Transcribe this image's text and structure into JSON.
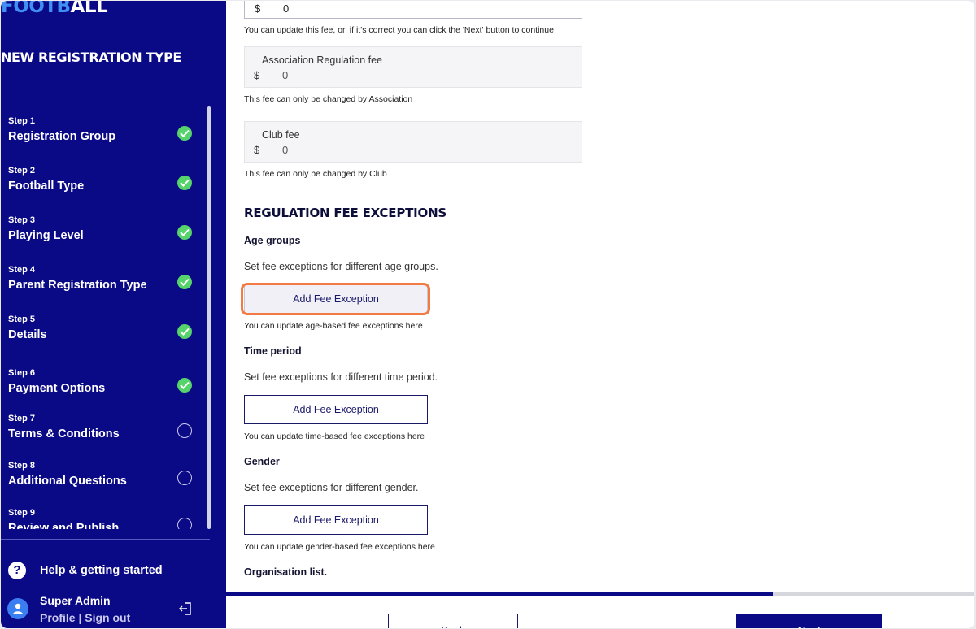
{
  "sidebar": {
    "logo_blue": "FOOTB",
    "logo_white": "ALL",
    "title": "NEW REGISTRATION TYPE",
    "steps": [
      {
        "num": "Step 1",
        "name": "Registration Group",
        "status": "complete"
      },
      {
        "num": "Step 2",
        "name": "Football Type",
        "status": "complete"
      },
      {
        "num": "Step 3",
        "name": "Playing Level",
        "status": "complete"
      },
      {
        "num": "Step 4",
        "name": "Parent Registration Type",
        "status": "complete"
      },
      {
        "num": "Step 5",
        "name": "Details",
        "status": "complete"
      },
      {
        "num": "Step 6",
        "name": "Payment Options",
        "status": "current"
      },
      {
        "num": "Step 7",
        "name": "Terms & Conditions",
        "status": "incomplete"
      },
      {
        "num": "Step 8",
        "name": "Additional Questions",
        "status": "incomplete"
      },
      {
        "num": "Step 9",
        "name": "Review and Publish",
        "status": "incomplete"
      }
    ],
    "help_label": "Help & getting started",
    "user_name": "Super Admin",
    "profile_link": "Profile",
    "separator": "|",
    "signout_link": "Sign out"
  },
  "fees": {
    "top_currency": "$",
    "top_value": "0",
    "top_hint": "You can update this fee, or, if it's correct you can click the 'Next' button to continue",
    "association": {
      "label": "Association Regulation fee",
      "currency": "$",
      "value": "0",
      "hint": "This fee can only be changed by Association"
    },
    "club": {
      "label": "Club fee",
      "currency": "$",
      "value": "0",
      "hint": "This fee can only be changed by Club"
    }
  },
  "exceptions": {
    "title": "REGULATION FEE EXCEPTIONS",
    "age": {
      "title": "Age groups",
      "desc": "Set fee exceptions for different age groups.",
      "button": "Add Fee Exception",
      "hint": "You can update age-based fee exceptions here"
    },
    "time": {
      "title": "Time period",
      "desc": "Set fee exceptions for different time period.",
      "button": "Add Fee Exception",
      "hint": "You can update time-based fee exceptions here"
    },
    "gender": {
      "title": "Gender",
      "desc": "Set fee exceptions for different gender.",
      "button": "Add Fee Exception",
      "hint": "You can update gender-based fee exceptions here"
    },
    "org_title": "Organisation list."
  },
  "progress": {
    "fraction": 0.73
  },
  "footer": {
    "back_label": "Back",
    "next_label": "Next"
  },
  "colors": {
    "sidebar_bg": "#0b0a86",
    "check_green": "#56d36b",
    "highlight": "#f27b44",
    "logo_blue": "#3f8ff5"
  }
}
